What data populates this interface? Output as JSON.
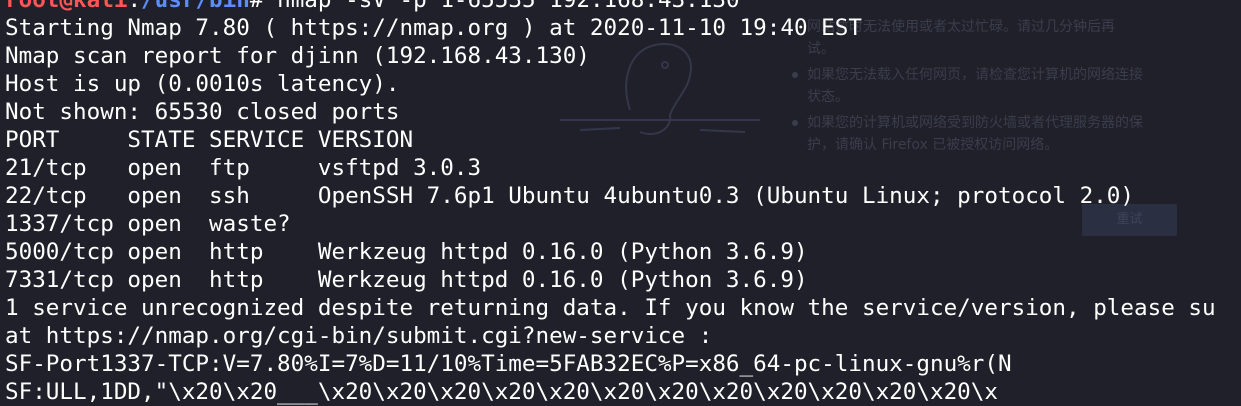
{
  "window": {
    "background": "#1f2029",
    "foreground": "#ffffff",
    "prompt_user_color": "#ff5555",
    "prompt_path_color": "#5c8cff"
  },
  "prompt": {
    "user": "root@kali",
    "sep": ":",
    "path": "/usr/bin",
    "symbol": "# ",
    "command": "nmap -sV -p 1-65535 192.168.43.130"
  },
  "output": {
    "lines": [
      "Starting Nmap 7.80 ( https://nmap.org ) at 2020-11-10 19:40 EST",
      "Nmap scan report for djinn (192.168.43.130)",
      "Host is up (0.0010s latency).",
      "Not shown: 65530 closed ports",
      "PORT     STATE SERVICE VERSION",
      "21/tcp   open  ftp     vsftpd 3.0.3",
      "22/tcp   open  ssh     OpenSSH 7.6p1 Ubuntu 4ubuntu0.3 (Ubuntu Linux; protocol 2.0)",
      "1337/tcp open  waste?",
      "5000/tcp open  http    Werkzeug httpd 0.16.0 (Python 3.6.9)",
      "7331/tcp open  http    Werkzeug httpd 0.16.0 (Python 3.6.9)",
      "1 service unrecognized despite returning data. If you know the service/version, please su",
      "at https://nmap.org/cgi-bin/submit.cgi?new-service :",
      "SF-Port1337-TCP:V=7.80%I=7%D=11/10%Time=5FAB32EC%P=x86_64-pc-linux-gnu%r(N",
      "SF:ULL,1DD,\"\\x20\\x20___\\x20\\x20\\x20\\x20\\x20\\x20\\x20\\x20\\x20\\x20\\x20\\x20\\x"
    ]
  },
  "background_browser": {
    "line1": "网站暂时无法使用或者太过忙碌。请过几分钟后再",
    "line1b": "试。",
    "line2": "如果您无法载入任何网页，请检查您计算机的网络连接",
    "line2b": "状态。",
    "line3": "如果您的计算机或网络受到防火墙或者代理服务器的保",
    "line3b": "护，请确认 Firefox 已被授权访问网络。",
    "button_label": "重试"
  }
}
